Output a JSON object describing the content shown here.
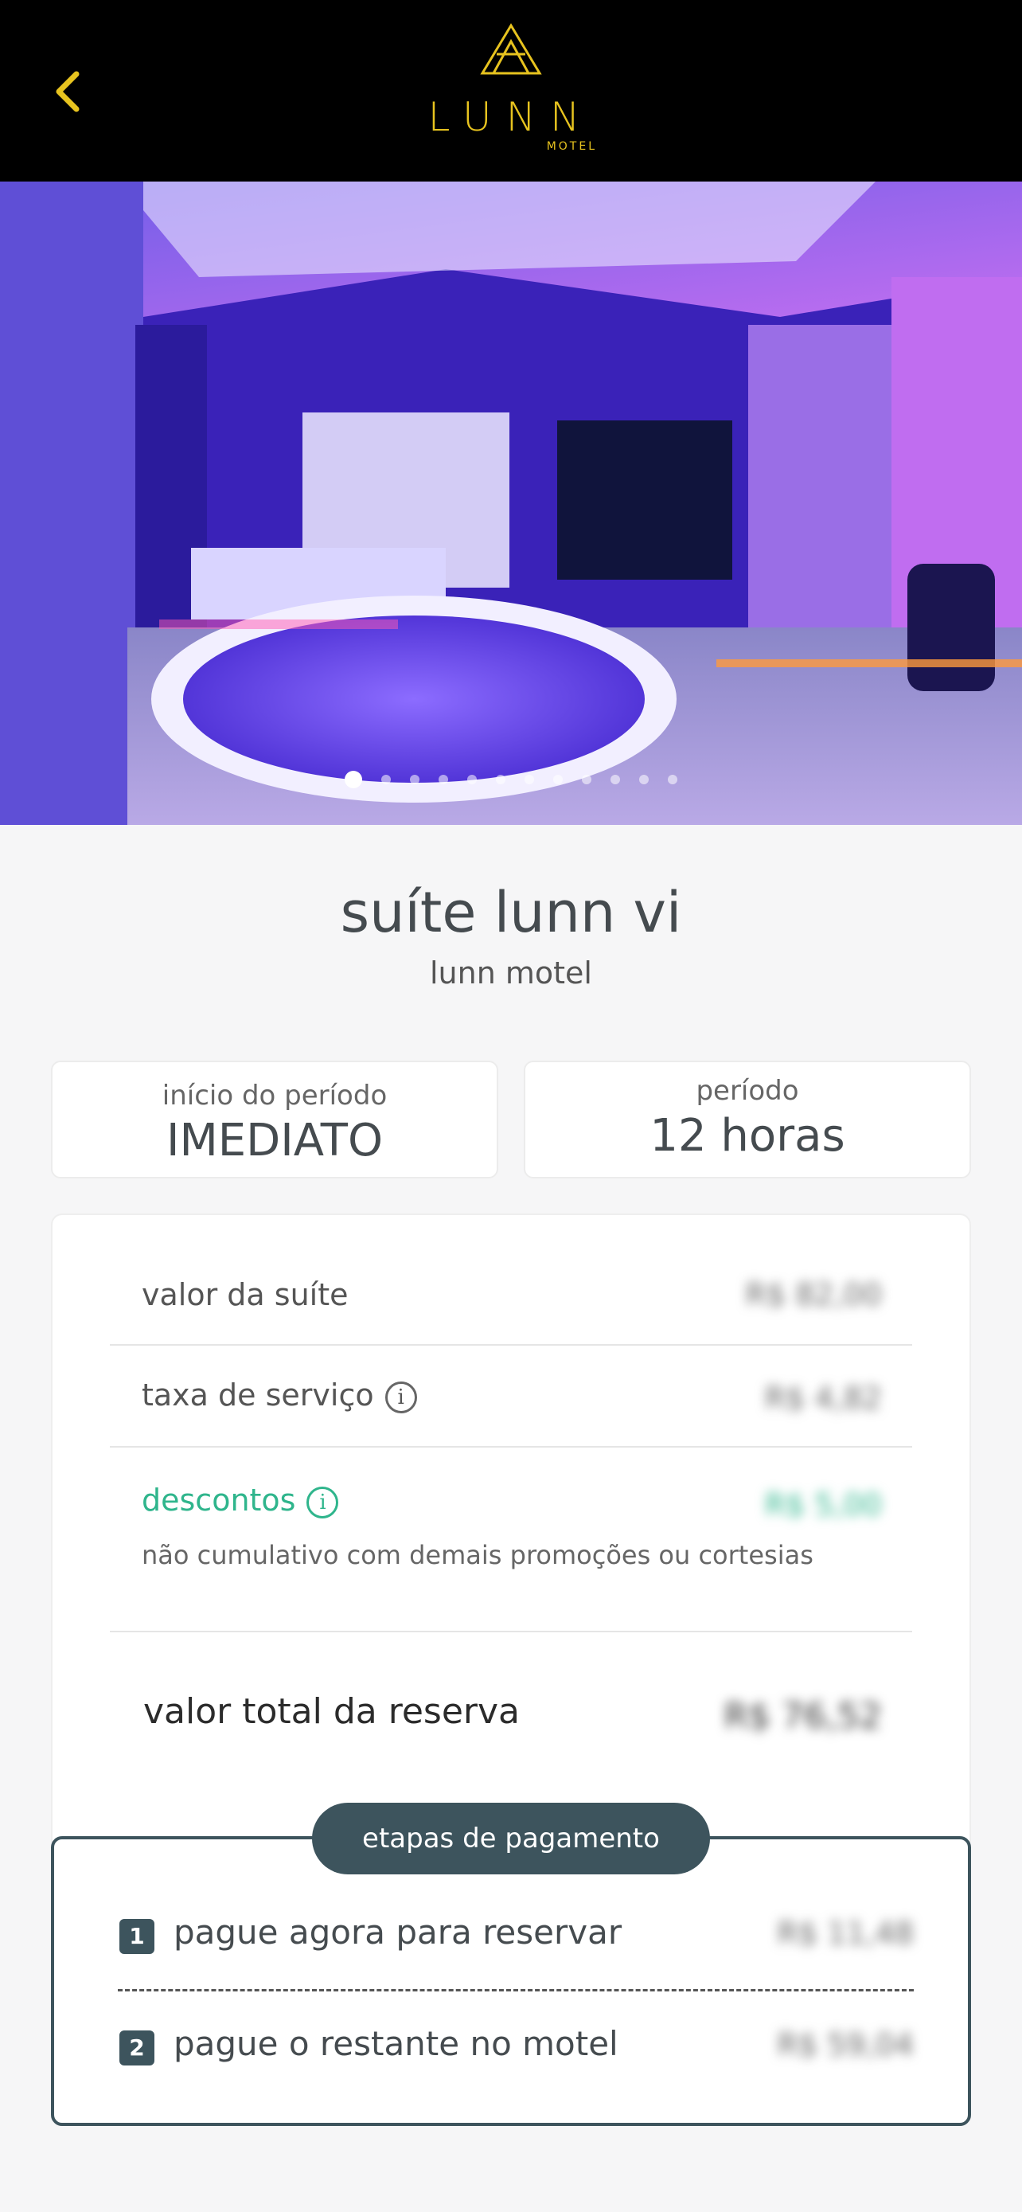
{
  "header": {
    "brand": "LUNN",
    "brand_sub": "MOTEL",
    "back_icon": "chevron-left-icon",
    "accent_color": "#e7c31f"
  },
  "gallery": {
    "total_images": 12,
    "active_index": 1
  },
  "suite": {
    "name": "suíte lunn vi",
    "motel": "lunn motel"
  },
  "period": {
    "start_label": "início do período",
    "start_value": "IMEDIATO",
    "length_label": "período",
    "length_value": "12 horas"
  },
  "summary": {
    "suite_label": "valor da suíte",
    "suite_value": "R$ 82,00",
    "fee_label": "taxa de serviço",
    "fee_value": "R$ 4,82",
    "discount_label": "descontos",
    "discount_value": "R$ 5,00",
    "discount_note": "não cumulativo com demais promoções ou cortesias",
    "discount_color": "#2fb58c",
    "total_label": "valor total da reserva",
    "total_value": "R$ 76,52"
  },
  "payment_steps": {
    "title": "etapas de pagamento",
    "step1_num": "1",
    "step1_label": "pague agora para reservar",
    "step1_value": "R$ 11,48",
    "step2_num": "2",
    "step2_label": "pague o restante no motel",
    "step2_value": "R$ 59,04",
    "color": "#3d545d"
  }
}
